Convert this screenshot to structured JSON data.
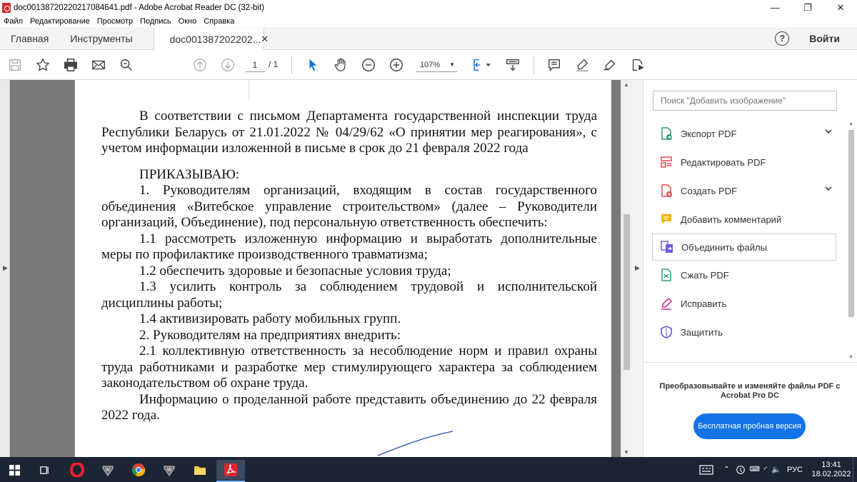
{
  "window": {
    "title": "doc0013872022021708464​1.pdf - Adobe Acrobat Reader DC (32-bit)",
    "minimize": "—",
    "maximize": "❐",
    "close": "✕"
  },
  "menu": {
    "items": [
      "Файл",
      "Редактирование",
      "Просмотр",
      "Подпись",
      "Окно",
      "Справка"
    ]
  },
  "tabs": {
    "home": "Главная",
    "tools": "Инструменты",
    "document": "doc001387202202...",
    "close": "✕",
    "help": "?",
    "login": "Войти"
  },
  "toolbar": {
    "page_current": "1",
    "page_total": "/ 1",
    "zoom": "107%"
  },
  "document": {
    "paragraphs": [
      "В соответствии с письмом Департамента государственной инспекции труда Республики Беларусь от 21.01.2022 № 04/29/62 «О принятии мер реагирования», с учетом информации изложенной в письме в срок до 21 февраля 2022 года",
      "ПРИКАЗЫВАЮ:",
      "1. Руководителям организаций, входящим в состав государственного объединения «Витебское управление строительством» (далее – Руководители организаций, Объединение), под персональную ответственность обеспечить:",
      "1.1 рассмотреть изложенную информацию и выработать дополнительные меры по профилактике производственного травматизма;",
      "1.2 обеспечить здоровые и безопасные условия труда;",
      "1.3 усилить контроль за соблюдением трудовой и исполнительской дисциплины работы;",
      "1.4  активизировать работу мобильных групп.",
      "2. Руководителям на предприятиях внедрить:",
      "2.1 коллективную ответственность за несоблюдение норм и правил охраны труда работниками и разработке мер стимулирующего характера за соблюдением законодательством об охране труда.",
      "Информацию о проделанной работе представить объединению до 22 февраля 2022 года."
    ]
  },
  "right_pane": {
    "search_placeholder": "Поиск \"Добавить изображение\"",
    "tools": [
      {
        "label": "Экспорт PDF",
        "icon": "export-pdf-icon",
        "color": "#2d9d78"
      },
      {
        "label": "Редактировать PDF",
        "icon": "edit-pdf-icon",
        "color": "#e34850"
      },
      {
        "label": "Создать PDF",
        "icon": "create-pdf-icon",
        "color": "#e34850"
      },
      {
        "label": "Добавить комментарий",
        "icon": "comment-icon",
        "color": "#f5b400"
      },
      {
        "label": "Объединить файлы",
        "icon": "combine-files-icon",
        "color": "#6c5ce7"
      },
      {
        "label": "Сжать PDF",
        "icon": "compress-pdf-icon",
        "color": "#2d9d78"
      },
      {
        "label": "Исправить",
        "icon": "fill-sign-icon",
        "color": "#cc3399"
      },
      {
        "label": "Защитить",
        "icon": "protect-icon",
        "color": "#5b5bd6"
      }
    ],
    "promo_text": "Преобразовывайте и изменяйте файлы PDF с Acrobat Pro DC",
    "promo_button": "Бесплатная пробная версия"
  },
  "taskbar": {
    "lang": "РУС",
    "time": "13:41",
    "date": "18.02.2022"
  },
  "colors": {
    "accent": "#1473e6",
    "taskbar": "#1c2533",
    "adobe_red": "#d7282f"
  }
}
